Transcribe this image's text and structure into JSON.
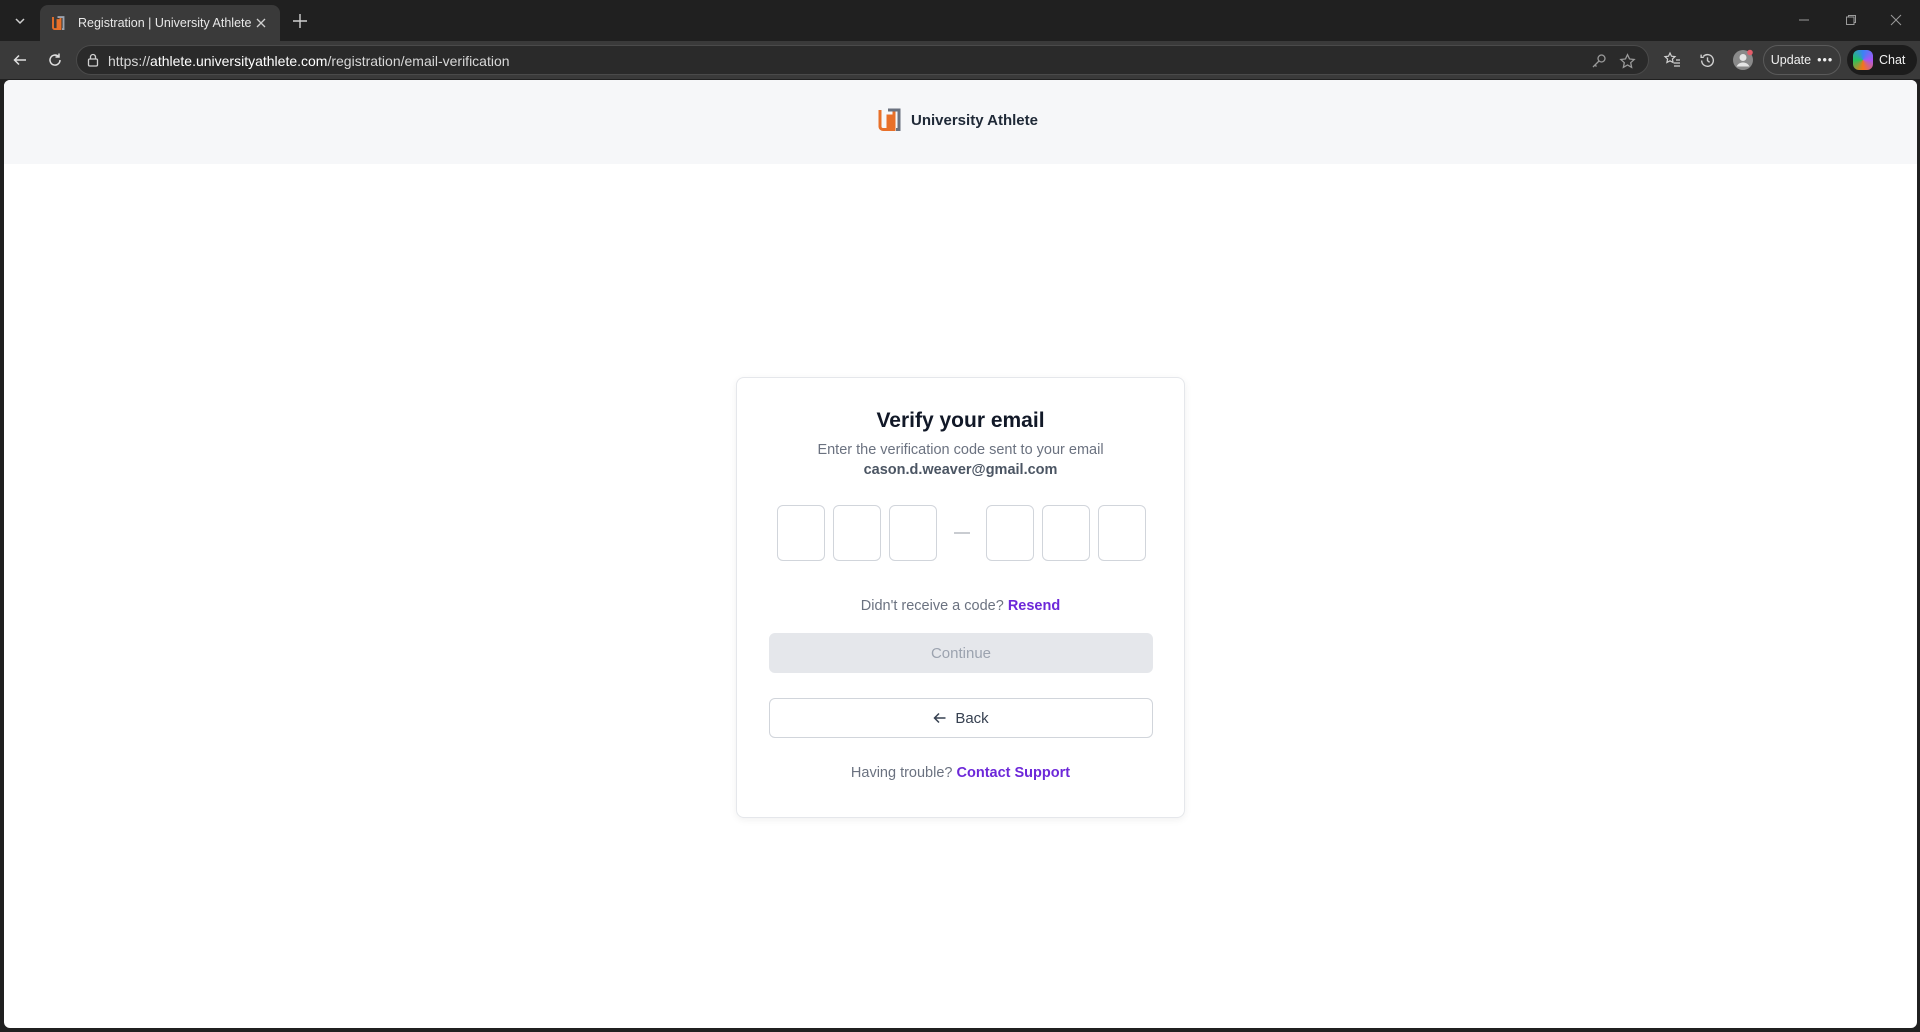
{
  "browser": {
    "tab_title": "Registration | University Athlete",
    "url_prefix": "https://",
    "url_host": "athlete.universityathlete.com",
    "url_path": "/registration/email-verification",
    "update_label": "Update",
    "chat_label": "Chat"
  },
  "header": {
    "brand_name": "University Athlete",
    "brand_colors": {
      "orange": "#e8702a",
      "gray": "#6b7280"
    }
  },
  "verify": {
    "title": "Verify your email",
    "subtitle": "Enter the verification code sent to your email",
    "email": "cason.d.weaver@gmail.com",
    "code_digits": [
      "",
      "",
      "",
      "",
      "",
      ""
    ],
    "resend_prompt": "Didn't receive a code?",
    "resend_link": "Resend",
    "continue_label": "Continue",
    "back_label": "Back",
    "support_prompt": "Having trouble?",
    "support_link": "Contact Support",
    "accent_color": "#6d28d9"
  }
}
